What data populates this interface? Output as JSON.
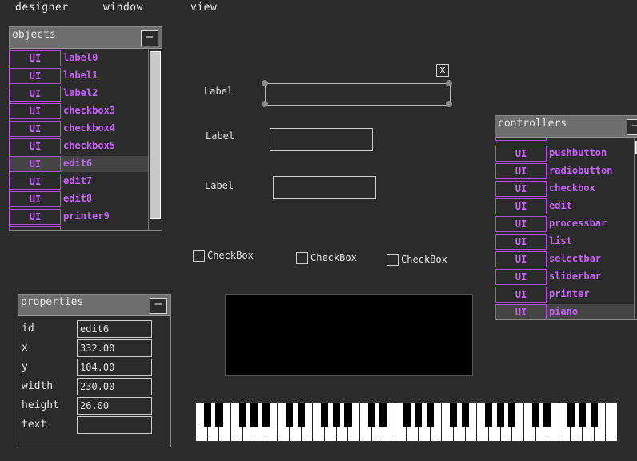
{
  "menu": [
    "designer",
    "window",
    "view"
  ],
  "objects_panel": {
    "title": "objects",
    "min_label": "—",
    "tag": "UI",
    "items": [
      "label0",
      "label1",
      "label2",
      "checkbox3",
      "checkbox4",
      "checkbox5",
      "edit6",
      "edit7",
      "edit8",
      "printer9"
    ],
    "selected": "edit6"
  },
  "canvas": {
    "close_label": "x",
    "labels": [
      "Label",
      "Label",
      "Label"
    ],
    "checkboxes": [
      "CheckBox",
      "CheckBox",
      "CheckBox"
    ]
  },
  "properties_panel": {
    "title": "properties",
    "min_label": "—",
    "fields": [
      {
        "key": "id",
        "value": "edit6"
      },
      {
        "key": "x",
        "value": "332.00"
      },
      {
        "key": "y",
        "value": "104.00"
      },
      {
        "key": "width",
        "value": "230.00"
      },
      {
        "key": "height",
        "value": "26.00"
      },
      {
        "key": "text",
        "value": ""
      }
    ]
  },
  "controllers_panel": {
    "title": "controllers",
    "min_label": "—",
    "tag": "UI",
    "items": [
      "pushbutton",
      "radiobutton",
      "checkbox",
      "edit",
      "processbar",
      "list",
      "selectbar",
      "sliderbar",
      "printer",
      "piano"
    ],
    "selected": "piano"
  },
  "colors": {
    "background": "#2b2b2b",
    "panel_header": "#6e6e6e",
    "accent_purple": "#c864f5"
  }
}
